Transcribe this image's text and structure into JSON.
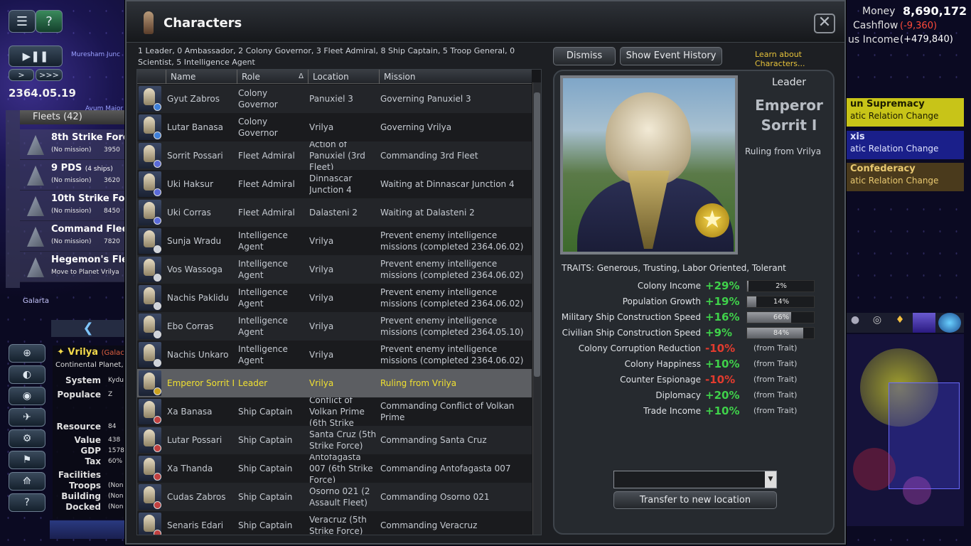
{
  "dialog": {
    "title": "Characters",
    "summary": "1 Leader, 0 Ambassador, 2 Colony Governor, 3 Fleet Admiral, 8 Ship Captain, 5 Troop General, 0 Scientist, 5 Intelligence Agent",
    "close_label": "✕",
    "dismiss_label": "Dismiss",
    "history_label": "Show Event History",
    "learn_label": "Learn about Characters...",
    "transfer_label": "Transfer to new location"
  },
  "table": {
    "headers": {
      "name": "Name",
      "role": "Role",
      "sort_arrow": "Δ",
      "location": "Location",
      "mission": "Mission"
    },
    "rows": [
      {
        "name": "Gyut Zabros",
        "role": "Colony Governor",
        "location": "Panuxiel 3",
        "mission": "Governing Panuxiel 3"
      },
      {
        "name": "Lutar Banasa",
        "role": "Colony Governor",
        "location": "Vrilya",
        "mission": "Governing Vrilya"
      },
      {
        "name": "Sorrit Possari",
        "role": "Fleet Admiral",
        "location": "Action of Panuxiel (3rd Fleet)",
        "mission": "Commanding 3rd Fleet"
      },
      {
        "name": "Uki Haksur",
        "role": "Fleet Admiral",
        "location": "Dinnascar Junction 4",
        "mission": "Waiting at Dinnascar Junction 4"
      },
      {
        "name": "Uki Corras",
        "role": "Fleet Admiral",
        "location": "Dalasteni 2",
        "mission": "Waiting at Dalasteni 2"
      },
      {
        "name": "Sunja Wradu",
        "role": "Intelligence Agent",
        "location": "Vrilya",
        "mission": "Prevent enemy intelligence missions (completed 2364.06.02)"
      },
      {
        "name": "Vos Wassoga",
        "role": "Intelligence Agent",
        "location": "Vrilya",
        "mission": "Prevent enemy intelligence missions (completed 2364.06.02)"
      },
      {
        "name": "Nachis Paklidu",
        "role": "Intelligence Agent",
        "location": "Vrilya",
        "mission": "Prevent enemy intelligence missions (completed 2364.06.02)"
      },
      {
        "name": "Ebo Corras",
        "role": "Intelligence Agent",
        "location": "Vrilya",
        "mission": "Prevent enemy intelligence missions (completed 2364.05.10)"
      },
      {
        "name": "Nachis Unkaro",
        "role": "Intelligence Agent",
        "location": "Vrilya",
        "mission": "Prevent enemy intelligence missions (completed 2364.06.02)"
      },
      {
        "name": "Emperor Sorrit I",
        "role": "Leader",
        "location": "Vrilya",
        "mission": "Ruling from Vrilya"
      },
      {
        "name": "Xa Banasa",
        "role": "Ship Captain",
        "location": "Conflict of Volkan Prime (6th Strike",
        "mission": "Commanding Conflict of Volkan Prime"
      },
      {
        "name": "Lutar Possari",
        "role": "Ship Captain",
        "location": "Santa Cruz (5th Strike Force)",
        "mission": "Commanding Santa Cruz"
      },
      {
        "name": "Xa Thanda",
        "role": "Ship Captain",
        "location": "Antofagasta 007 (6th Strike Force)",
        "mission": "Commanding Antofagasta 007"
      },
      {
        "name": "Cudas Zabros",
        "role": "Ship Captain",
        "location": "Osorno 021 (2 Assault Fleet)",
        "mission": "Commanding Osorno 021"
      },
      {
        "name": "Senaris Edari",
        "role": "Ship Captain",
        "location": "Veracruz (5th Strike Force)",
        "mission": "Commanding Veracruz"
      }
    ]
  },
  "detail": {
    "role": "Leader",
    "name_line1": "Emperor",
    "name_line2": "Sorrit I",
    "status": "Ruling from Vrilya",
    "traits": "TRAITS: Generous, Trusting, Labor Oriented, Tolerant",
    "bonuses": [
      {
        "label": "Colony Income",
        "value": "+29%",
        "bar_text": "2%",
        "fill": 0.02,
        "color": "#3fd14a"
      },
      {
        "label": "Population Growth",
        "value": "+19%",
        "bar_text": "14%",
        "fill": 0.14,
        "color": "#3fd14a"
      },
      {
        "label": "Military Ship Construction Speed",
        "value": "+16%",
        "bar_text": "66%",
        "fill": 0.66,
        "color": "#3fd14a"
      },
      {
        "label": "Civilian Ship Construction Speed",
        "value": "+9%",
        "bar_text": "84%",
        "fill": 0.84,
        "color": "#3fd14a"
      },
      {
        "label": "Colony Corruption Reduction",
        "value": "-10%",
        "source": "(from Trait)",
        "color": "#e23b2e"
      },
      {
        "label": "Colony Happiness",
        "value": "+10%",
        "source": "(from Trait)",
        "color": "#3fd14a"
      },
      {
        "label": "Counter Espionage",
        "value": "-10%",
        "source": "(from Trait)",
        "color": "#e23b2e"
      },
      {
        "label": "Diplomacy",
        "value": "+20%",
        "source": "(from Trait)",
        "color": "#3fd14a"
      },
      {
        "label": "Trade Income",
        "value": "+10%",
        "source": "(from Trait)",
        "color": "#3fd14a"
      }
    ]
  },
  "left": {
    "date": "2364.05.19",
    "play_label": "▶❚❚",
    "speed1": ">",
    "speed2": ">>>",
    "fleets_header": "Fleets (42)",
    "fleets": [
      {
        "name": "8th Strike Force",
        "status": "(No mission)",
        "value": "3950"
      },
      {
        "name": "9 PDS",
        "count": "(4 ships)",
        "status": "(No mission)",
        "value": "3620"
      },
      {
        "name": "10th Strike Force",
        "status": "(No mission)",
        "value": "8450"
      },
      {
        "name": "Command Fleet",
        "status": "(No mission)",
        "value": "7820"
      },
      {
        "name": "Hegemon's Flee",
        "status": "Move to Planet Vrilya",
        "value": ""
      }
    ],
    "map_labels": {
      "a": "Galarta",
      "b": "Muresham Junc",
      "c": "Ayum Major"
    },
    "collapse": "❮",
    "planet": {
      "name": "Vrilya",
      "tag": "(Galacti",
      "type": "Continental Planet, 3",
      "rows": [
        {
          "label": "System",
          "value": "Kydu"
        },
        {
          "label": "Populace",
          "value": "Z"
        },
        {
          "label": "Resource",
          "value": "84"
        },
        {
          "label": "Value",
          "value": "438"
        },
        {
          "label": "GDP",
          "value": "1578"
        },
        {
          "label": "Tax",
          "value": "60%"
        },
        {
          "label": "Facilities",
          "value": ""
        },
        {
          "label": "Troops",
          "value": "(Non"
        },
        {
          "label": "Building",
          "value": "(Non"
        },
        {
          "label": "Docked",
          "value": "(Non"
        }
      ]
    }
  },
  "right": {
    "money_label": "Money",
    "money_value": "8,690,172",
    "cashflow_label": "Cashflow",
    "cashflow_value": "(-9,360)",
    "income_label": "us Income",
    "income_value": "(+479,840)",
    "diplomacy": [
      {
        "title": "un Supremacy",
        "sub": "atic Relation Change",
        "bg": "#c8c418",
        "fg": "#1b1b00"
      },
      {
        "title": "xis",
        "sub": "atic Relation Change",
        "bg": "#1a1f8a",
        "fg": "#e0e4ff"
      },
      {
        "title": "Confederacy",
        "sub": "atic Relation Change",
        "bg": "#4a3a1c",
        "fg": "#e8c870"
      }
    ]
  },
  "colors": {
    "accent": "#e6c23a",
    "selected_text": "#f0e030",
    "positive": "#3fd14a",
    "negative": "#e23b2e"
  }
}
